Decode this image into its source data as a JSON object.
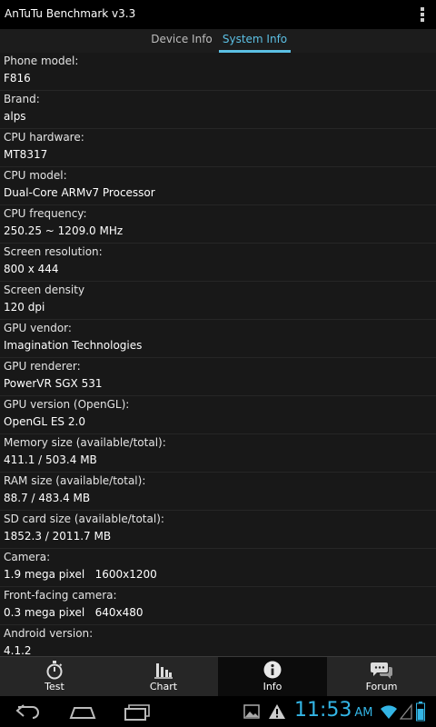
{
  "app": {
    "title": "AnTuTu Benchmark v3.3"
  },
  "tabs": [
    {
      "label": "Device Info",
      "active": false
    },
    {
      "label": "System Info",
      "active": true
    }
  ],
  "info_rows": [
    {
      "label": "Phone model:",
      "value": "F816"
    },
    {
      "label": "Brand:",
      "value": "alps"
    },
    {
      "label": "CPU hardware:",
      "value": "MT8317"
    },
    {
      "label": "CPU model:",
      "value": "Dual-Core ARMv7 Processor"
    },
    {
      "label": "CPU frequency:",
      "value": "250.25 ~ 1209.0 MHz"
    },
    {
      "label": "Screen resolution:",
      "value": "800 x 444"
    },
    {
      "label": "Screen density",
      "value": "120 dpi"
    },
    {
      "label": "GPU vendor:",
      "value": "Imagination Technologies"
    },
    {
      "label": "GPU renderer:",
      "value": "PowerVR SGX 531"
    },
    {
      "label": "GPU version (OpenGL):",
      "value": "OpenGL ES 2.0"
    },
    {
      "label": "Memory size (available/total):",
      "value": "411.1 / 503.4 MB"
    },
    {
      "label": "RAM size (available/total):",
      "value": "88.7 / 483.4 MB"
    },
    {
      "label": "SD card size (available/total):",
      "value": "1852.3 / 2011.7 MB"
    },
    {
      "label": "Camera:",
      "value": "1.9 mega pixel   1600x1200"
    },
    {
      "label": "Front-facing camera:",
      "value": "0.3 mega pixel   640x480"
    },
    {
      "label": "Android version:",
      "value": "4.1.2"
    }
  ],
  "bottom_nav": [
    {
      "label": "Test",
      "icon": "stopwatch-icon",
      "active": false
    },
    {
      "label": "Chart",
      "icon": "bar-chart-icon",
      "active": false
    },
    {
      "label": "Info",
      "icon": "info-icon",
      "active": true
    },
    {
      "label": "Forum",
      "icon": "chat-bubbles-icon",
      "active": false
    }
  ],
  "status": {
    "time": "11:53",
    "ampm": "AM",
    "icons": [
      "gallery-icon",
      "warning-icon",
      "wifi-icon",
      "signal-icon",
      "battery-icon"
    ]
  },
  "system_nav": [
    "back-icon",
    "home-icon",
    "recent-apps-icon"
  ],
  "colors": {
    "accent": "#33b5e5",
    "background": "#181818",
    "navbar": "#262626"
  }
}
